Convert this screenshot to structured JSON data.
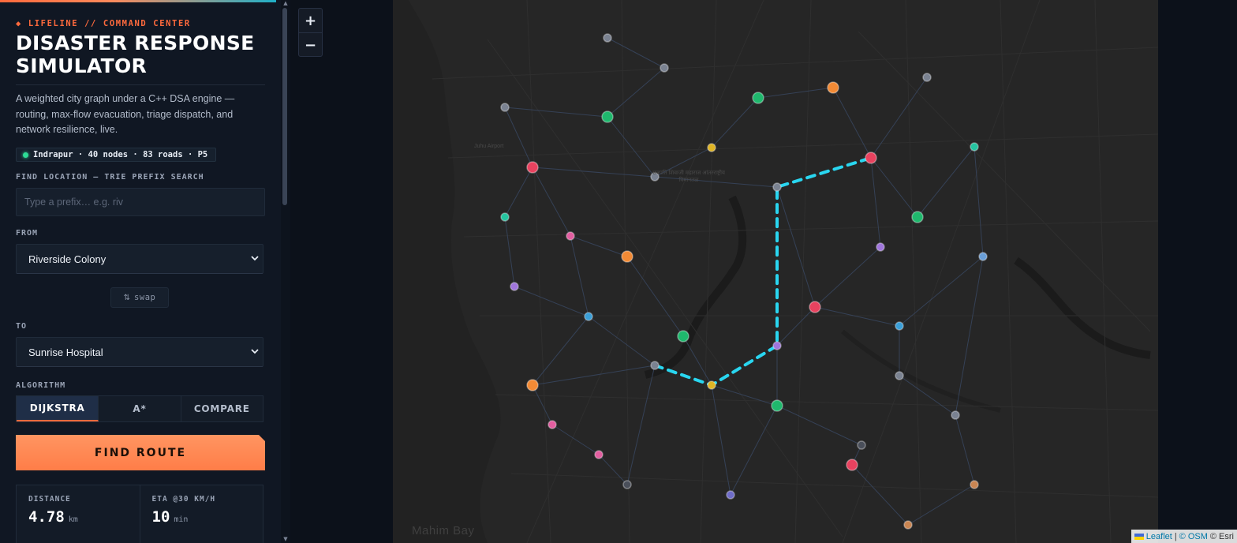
{
  "sidebar": {
    "eyebrow": "◆ LIFELINE // COMMAND CENTER",
    "title": "DISASTER RESPONSE SIMULATOR",
    "description": "A weighted city graph under a C++ DSA engine — routing, max-flow evacuation, triage dispatch, and network resilience, live.",
    "status_pill": "Indrapur · 40 nodes · 83 roads · P5",
    "find_location": {
      "label": "FIND LOCATION — TRIE PREFIX SEARCH",
      "placeholder": "Type a prefix… e.g. riv",
      "value": ""
    },
    "from": {
      "label": "FROM",
      "value": "Riverside Colony"
    },
    "swap_label": "swap",
    "to": {
      "label": "TO",
      "value": "Sunrise Hospital"
    },
    "algorithm": {
      "label": "ALGORITHM",
      "options": [
        "DIJKSTRA",
        "A*",
        "COMPARE"
      ],
      "selected": "DIJKSTRA"
    },
    "find_route_label": "FIND ROUTE",
    "stats": [
      {
        "label": "DISTANCE",
        "value": "4.78",
        "unit": "km"
      },
      {
        "label": "ETA @30 KM/H",
        "value": "10",
        "unit": "min"
      }
    ]
  },
  "map": {
    "zoom_in": "+",
    "zoom_out": "−",
    "labels": {
      "bay": "Mahim Bay",
      "airport": "Juhu Airport",
      "poi": "छत्रपति शिवाजी महाराज आंतरराष्ट्रीय विमानतळ"
    },
    "attribution": {
      "leaflet": "Leaflet",
      "sep": "|",
      "osm": "© OSM",
      "esri": "© Esri"
    },
    "colors": {
      "route": "#29d6f0",
      "hospital": "#e8425f",
      "shelter": "#1fb86d",
      "fire": "#f28a35",
      "police": "#3a9fd8",
      "junction": "#7a8291",
      "residential": "#a076dc",
      "school": "#e25ea0",
      "market": "#e0b524",
      "depot": "#25c4a0"
    }
  }
}
